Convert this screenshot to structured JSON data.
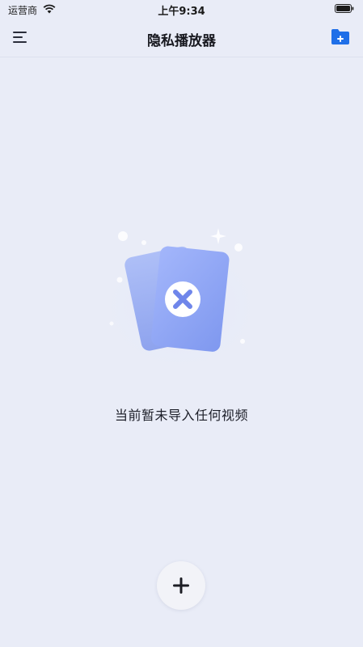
{
  "status_bar": {
    "carrier": "运营商",
    "time": "上午9:34",
    "wifi_icon": "wifi-icon",
    "battery_icon": "battery-icon"
  },
  "header": {
    "title": "隐私播放器",
    "menu_icon": "menu-icon",
    "add_folder_icon": "folder-add-icon"
  },
  "empty_state": {
    "message": "当前暂未导入任何视频",
    "illustration_icon": "empty-cards-icon"
  },
  "fab": {
    "icon": "plus-icon"
  },
  "colors": {
    "background": "#e9ecf7",
    "accent": "#1f6fe8",
    "card_blue": "#8ea7f4"
  }
}
